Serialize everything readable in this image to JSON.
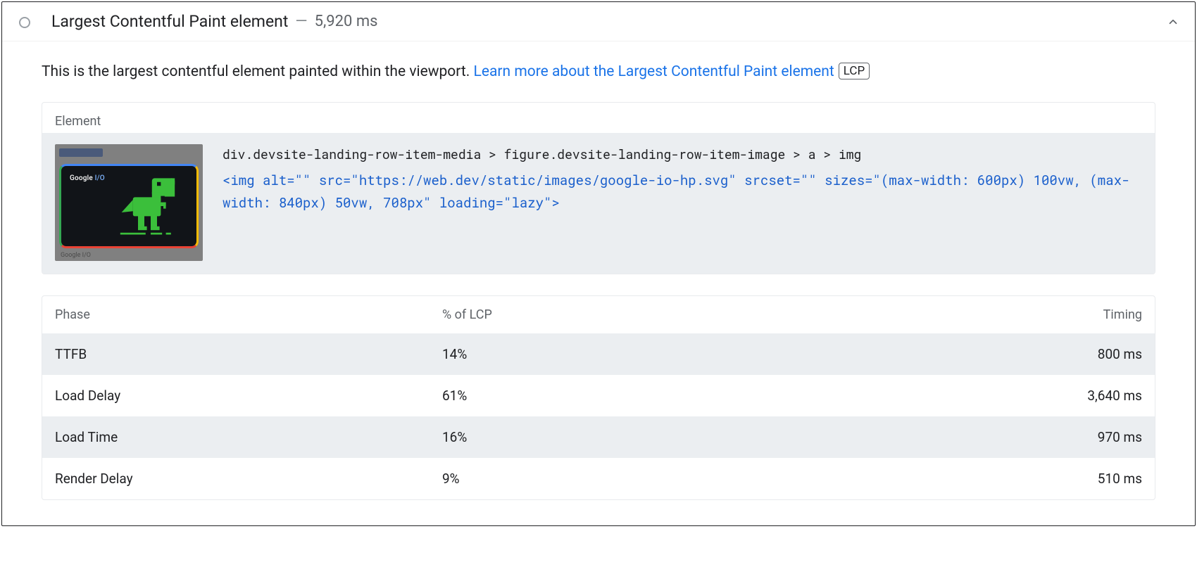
{
  "audit": {
    "title": "Largest Contentful Paint element",
    "dash": "—",
    "time": "5,920 ms"
  },
  "description": {
    "text": "This is the largest contentful element painted within the viewport. ",
    "link_text": "Learn more about the Largest Contentful Paint element",
    "badge": "LCP"
  },
  "element_section": {
    "header": "Element",
    "selector_path": "div.devsite-landing-row-item-media > figure.devsite-landing-row-item-image > a > img",
    "html_snippet": "<img alt=\"\" src=\"https://web.dev/static/images/google-io-hp.svg\" srcset=\"\" sizes=\"(max-width: 600px) 100vw, (max-width: 840px) 50vw, 708px\" loading=\"lazy\">",
    "thumb": {
      "logo_text": "Google ",
      "logo_io": "I/O",
      "bottom_text": "Google I/O"
    }
  },
  "phase_table": {
    "headers": {
      "phase": "Phase",
      "pct": "% of LCP",
      "timing": "Timing"
    },
    "rows": [
      {
        "phase": "TTFB",
        "pct": "14%",
        "timing": "800 ms"
      },
      {
        "phase": "Load Delay",
        "pct": "61%",
        "timing": "3,640 ms"
      },
      {
        "phase": "Load Time",
        "pct": "16%",
        "timing": "970 ms"
      },
      {
        "phase": "Render Delay",
        "pct": "9%",
        "timing": "510 ms"
      }
    ]
  }
}
